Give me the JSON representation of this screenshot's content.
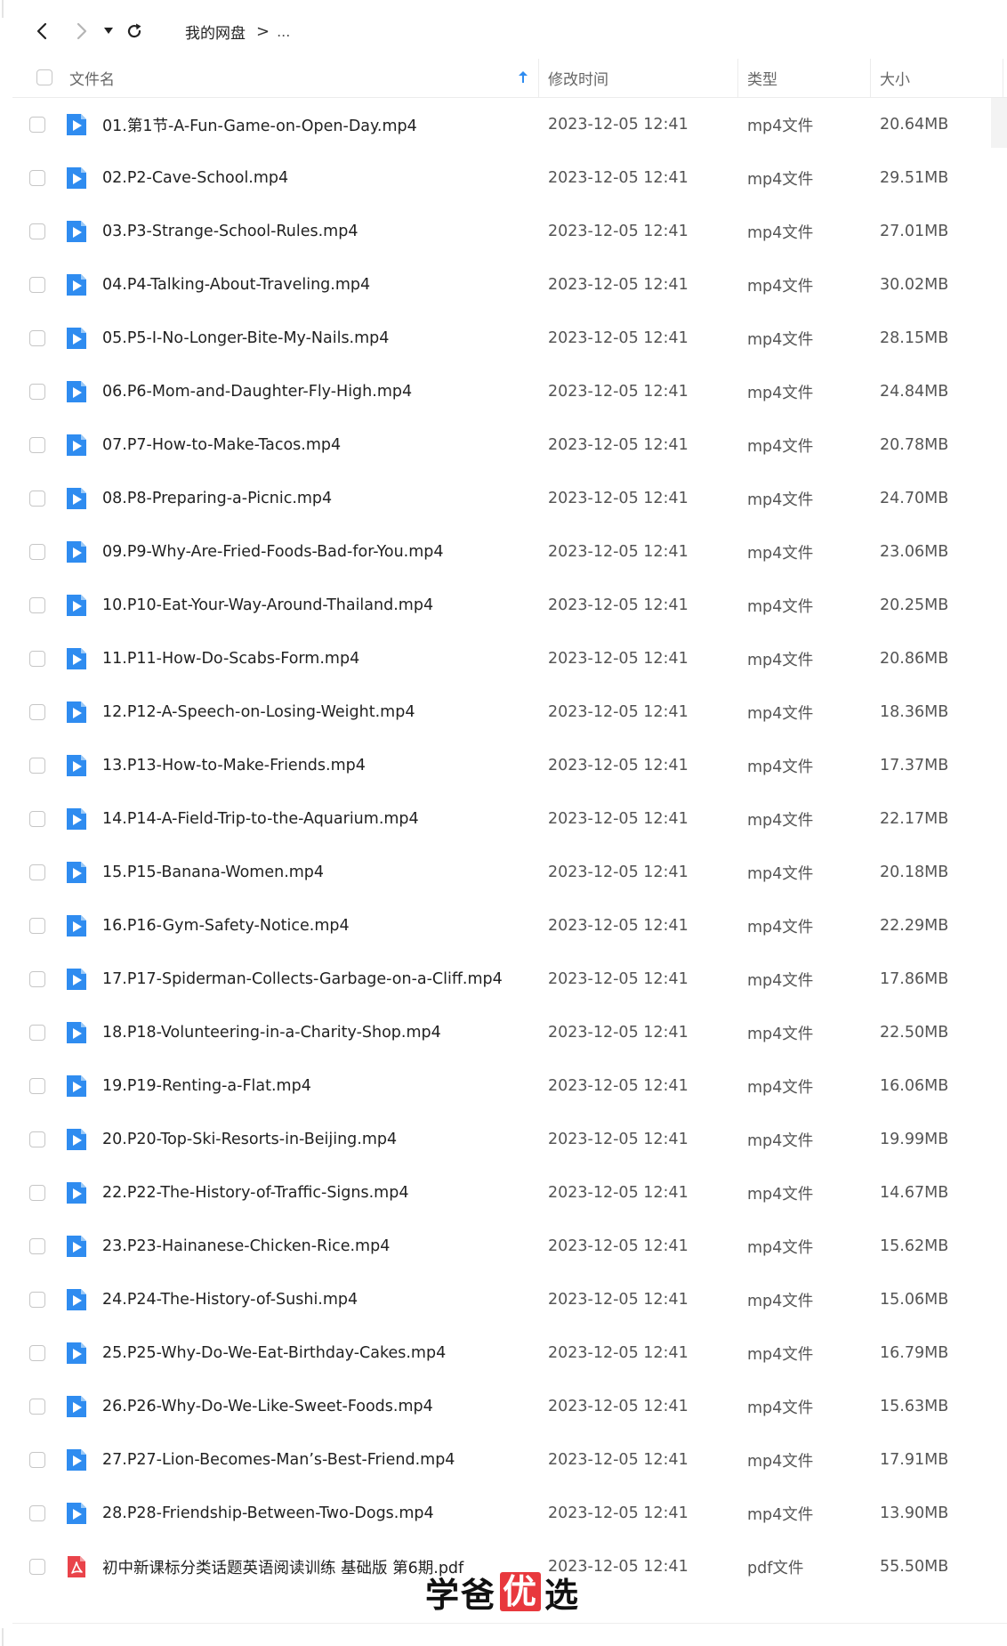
{
  "breadcrumb": {
    "root": "我的网盘",
    "separator": ">",
    "more": "..."
  },
  "header": {
    "name": "文件名",
    "modified": "修改时间",
    "type": "类型",
    "size": "大小"
  },
  "colors": {
    "video_icon": "#2f8cf0",
    "pdf_icon": "#e9434a",
    "sort_arrow": "#2f8cf0"
  },
  "files": [
    {
      "name": "01.第1节-A-Fun-Game-on-Open-Day.mp4",
      "date": "2023-12-05 12:41",
      "type": "mp4文件",
      "size": "20.64MB",
      "icon": "video-file-icon"
    },
    {
      "name": "02.P2-Cave-School.mp4",
      "date": "2023-12-05 12:41",
      "type": "mp4文件",
      "size": "29.51MB",
      "icon": "video-file-icon"
    },
    {
      "name": "03.P3-Strange-School-Rules.mp4",
      "date": "2023-12-05 12:41",
      "type": "mp4文件",
      "size": "27.01MB",
      "icon": "video-file-icon"
    },
    {
      "name": "04.P4-Talking-About-Traveling.mp4",
      "date": "2023-12-05 12:41",
      "type": "mp4文件",
      "size": "30.02MB",
      "icon": "video-file-icon"
    },
    {
      "name": "05.P5-I-No-Longer-Bite-My-Nails.mp4",
      "date": "2023-12-05 12:41",
      "type": "mp4文件",
      "size": "28.15MB",
      "icon": "video-file-icon"
    },
    {
      "name": "06.P6-Mom-and-Daughter-Fly-High.mp4",
      "date": "2023-12-05 12:41",
      "type": "mp4文件",
      "size": "24.84MB",
      "icon": "video-file-icon"
    },
    {
      "name": "07.P7-How-to-Make-Tacos.mp4",
      "date": "2023-12-05 12:41",
      "type": "mp4文件",
      "size": "20.78MB",
      "icon": "video-file-icon"
    },
    {
      "name": "08.P8-Preparing-a-Picnic.mp4",
      "date": "2023-12-05 12:41",
      "type": "mp4文件",
      "size": "24.70MB",
      "icon": "video-file-icon"
    },
    {
      "name": "09.P9-Why-Are-Fried-Foods-Bad-for-You.mp4",
      "date": "2023-12-05 12:41",
      "type": "mp4文件",
      "size": "23.06MB",
      "icon": "video-file-icon"
    },
    {
      "name": "10.P10-Eat-Your-Way-Around-Thailand.mp4",
      "date": "2023-12-05 12:41",
      "type": "mp4文件",
      "size": "20.25MB",
      "icon": "video-file-icon"
    },
    {
      "name": "11.P11-How-Do-Scabs-Form.mp4",
      "date": "2023-12-05 12:41",
      "type": "mp4文件",
      "size": "20.86MB",
      "icon": "video-file-icon"
    },
    {
      "name": "12.P12-A-Speech-on-Losing-Weight.mp4",
      "date": "2023-12-05 12:41",
      "type": "mp4文件",
      "size": "18.36MB",
      "icon": "video-file-icon"
    },
    {
      "name": "13.P13-How-to-Make-Friends.mp4",
      "date": "2023-12-05 12:41",
      "type": "mp4文件",
      "size": "17.37MB",
      "icon": "video-file-icon"
    },
    {
      "name": "14.P14-A-Field-Trip-to-the-Aquarium.mp4",
      "date": "2023-12-05 12:41",
      "type": "mp4文件",
      "size": "22.17MB",
      "icon": "video-file-icon"
    },
    {
      "name": "15.P15-Banana-Women.mp4",
      "date": "2023-12-05 12:41",
      "type": "mp4文件",
      "size": "20.18MB",
      "icon": "video-file-icon"
    },
    {
      "name": "16.P16-Gym-Safety-Notice.mp4",
      "date": "2023-12-05 12:41",
      "type": "mp4文件",
      "size": "22.29MB",
      "icon": "video-file-icon"
    },
    {
      "name": "17.P17-Spiderman-Collects-Garbage-on-a-Cliff.mp4",
      "date": "2023-12-05 12:41",
      "type": "mp4文件",
      "size": "17.86MB",
      "icon": "video-file-icon"
    },
    {
      "name": "18.P18-Volunteering-in-a-Charity-Shop.mp4",
      "date": "2023-12-05 12:41",
      "type": "mp4文件",
      "size": "22.50MB",
      "icon": "video-file-icon"
    },
    {
      "name": "19.P19-Renting-a-Flat.mp4",
      "date": "2023-12-05 12:41",
      "type": "mp4文件",
      "size": "16.06MB",
      "icon": "video-file-icon"
    },
    {
      "name": "20.P20-Top-Ski-Resorts-in-Beijing.mp4",
      "date": "2023-12-05 12:41",
      "type": "mp4文件",
      "size": "19.99MB",
      "icon": "video-file-icon"
    },
    {
      "name": "22.P22-The-History-of-Traffic-Signs.mp4",
      "date": "2023-12-05 12:41",
      "type": "mp4文件",
      "size": "14.67MB",
      "icon": "video-file-icon"
    },
    {
      "name": "23.P23-Hainanese-Chicken-Rice.mp4",
      "date": "2023-12-05 12:41",
      "type": "mp4文件",
      "size": "15.62MB",
      "icon": "video-file-icon"
    },
    {
      "name": "24.P24-The-History-of-Sushi.mp4",
      "date": "2023-12-05 12:41",
      "type": "mp4文件",
      "size": "15.06MB",
      "icon": "video-file-icon"
    },
    {
      "name": "25.P25-Why-Do-We-Eat-Birthday-Cakes.mp4",
      "date": "2023-12-05 12:41",
      "type": "mp4文件",
      "size": "16.79MB",
      "icon": "video-file-icon"
    },
    {
      "name": "26.P26-Why-Do-We-Like-Sweet-Foods.mp4",
      "date": "2023-12-05 12:41",
      "type": "mp4文件",
      "size": "15.63MB",
      "icon": "video-file-icon"
    },
    {
      "name": "27.P27-Lion-Becomes-Man’s-Best-Friend.mp4",
      "date": "2023-12-05 12:41",
      "type": "mp4文件",
      "size": "17.91MB",
      "icon": "video-file-icon"
    },
    {
      "name": "28.P28-Friendship-Between-Two-Dogs.mp4",
      "date": "2023-12-05 12:41",
      "type": "mp4文件",
      "size": "13.90MB",
      "icon": "video-file-icon"
    },
    {
      "name": "初中新课标分类话题英语阅读训练 基础版 第6期.pdf",
      "date": "2023-12-05 12:41",
      "type": "pdf文件",
      "size": "55.50MB",
      "icon": "pdf-file-icon"
    }
  ],
  "watermark": {
    "part1": "学爸",
    "highlight": "优",
    "part2": "选"
  }
}
